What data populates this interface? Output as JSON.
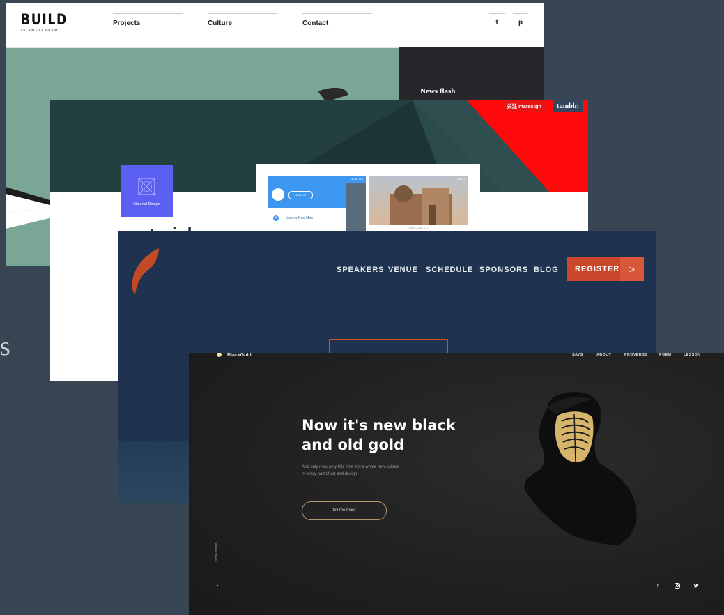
{
  "partial_left_text": "s",
  "card_build": {
    "logo_main": "BUILD",
    "logo_sub": "IN AMSTERDAM",
    "nav": [
      "Projects",
      "Culture",
      "Contact"
    ],
    "social": [
      "f",
      "p"
    ],
    "news_title": "News flash",
    "colors": {
      "hero_bg": "#7aa696",
      "news_bg": "#27272b"
    }
  },
  "card_material": {
    "topbar_left": "关注 matesign",
    "topbar_right": "tumblr.",
    "badge_label": "Material Design",
    "partial_title": "material",
    "phone_left": {
      "status": "12:46 am",
      "sign_in": "SIGN IN",
      "menu_item": "Make a New Map"
    },
    "phone_right": {
      "status": "12:46",
      "caption": "WELCOME TO"
    },
    "colors": {
      "top_bg": "#233f40",
      "red": "#ff0000",
      "badge": "#5b60f2"
    }
  },
  "card_conference": {
    "nav": [
      "SPEAKERS",
      "VENUE",
      "SCHEDULE",
      "SPONSORS",
      "BLOG"
    ],
    "register_label": "REGISTER",
    "register_arrow": ">",
    "colors": {
      "bg": "#1f3350",
      "accent": "#c9472b"
    }
  },
  "card_blackgold": {
    "brand": "BlackGold",
    "nav": [
      "SAYS",
      "ABOUT",
      "PROVERBS",
      "POEM",
      "LESSON"
    ],
    "headline_line1": "Now it's new black",
    "headline_line2": "and old gold",
    "sub_line1": "And only now, only this time it is a whole new culture",
    "sub_line2": "in every part of art and design",
    "cta": "tell me more",
    "scroll_label": "scroll down",
    "social": [
      "f",
      "ig",
      "t"
    ],
    "colors": {
      "bg": "#1e1e1e",
      "gold": "#d6b46a"
    }
  }
}
